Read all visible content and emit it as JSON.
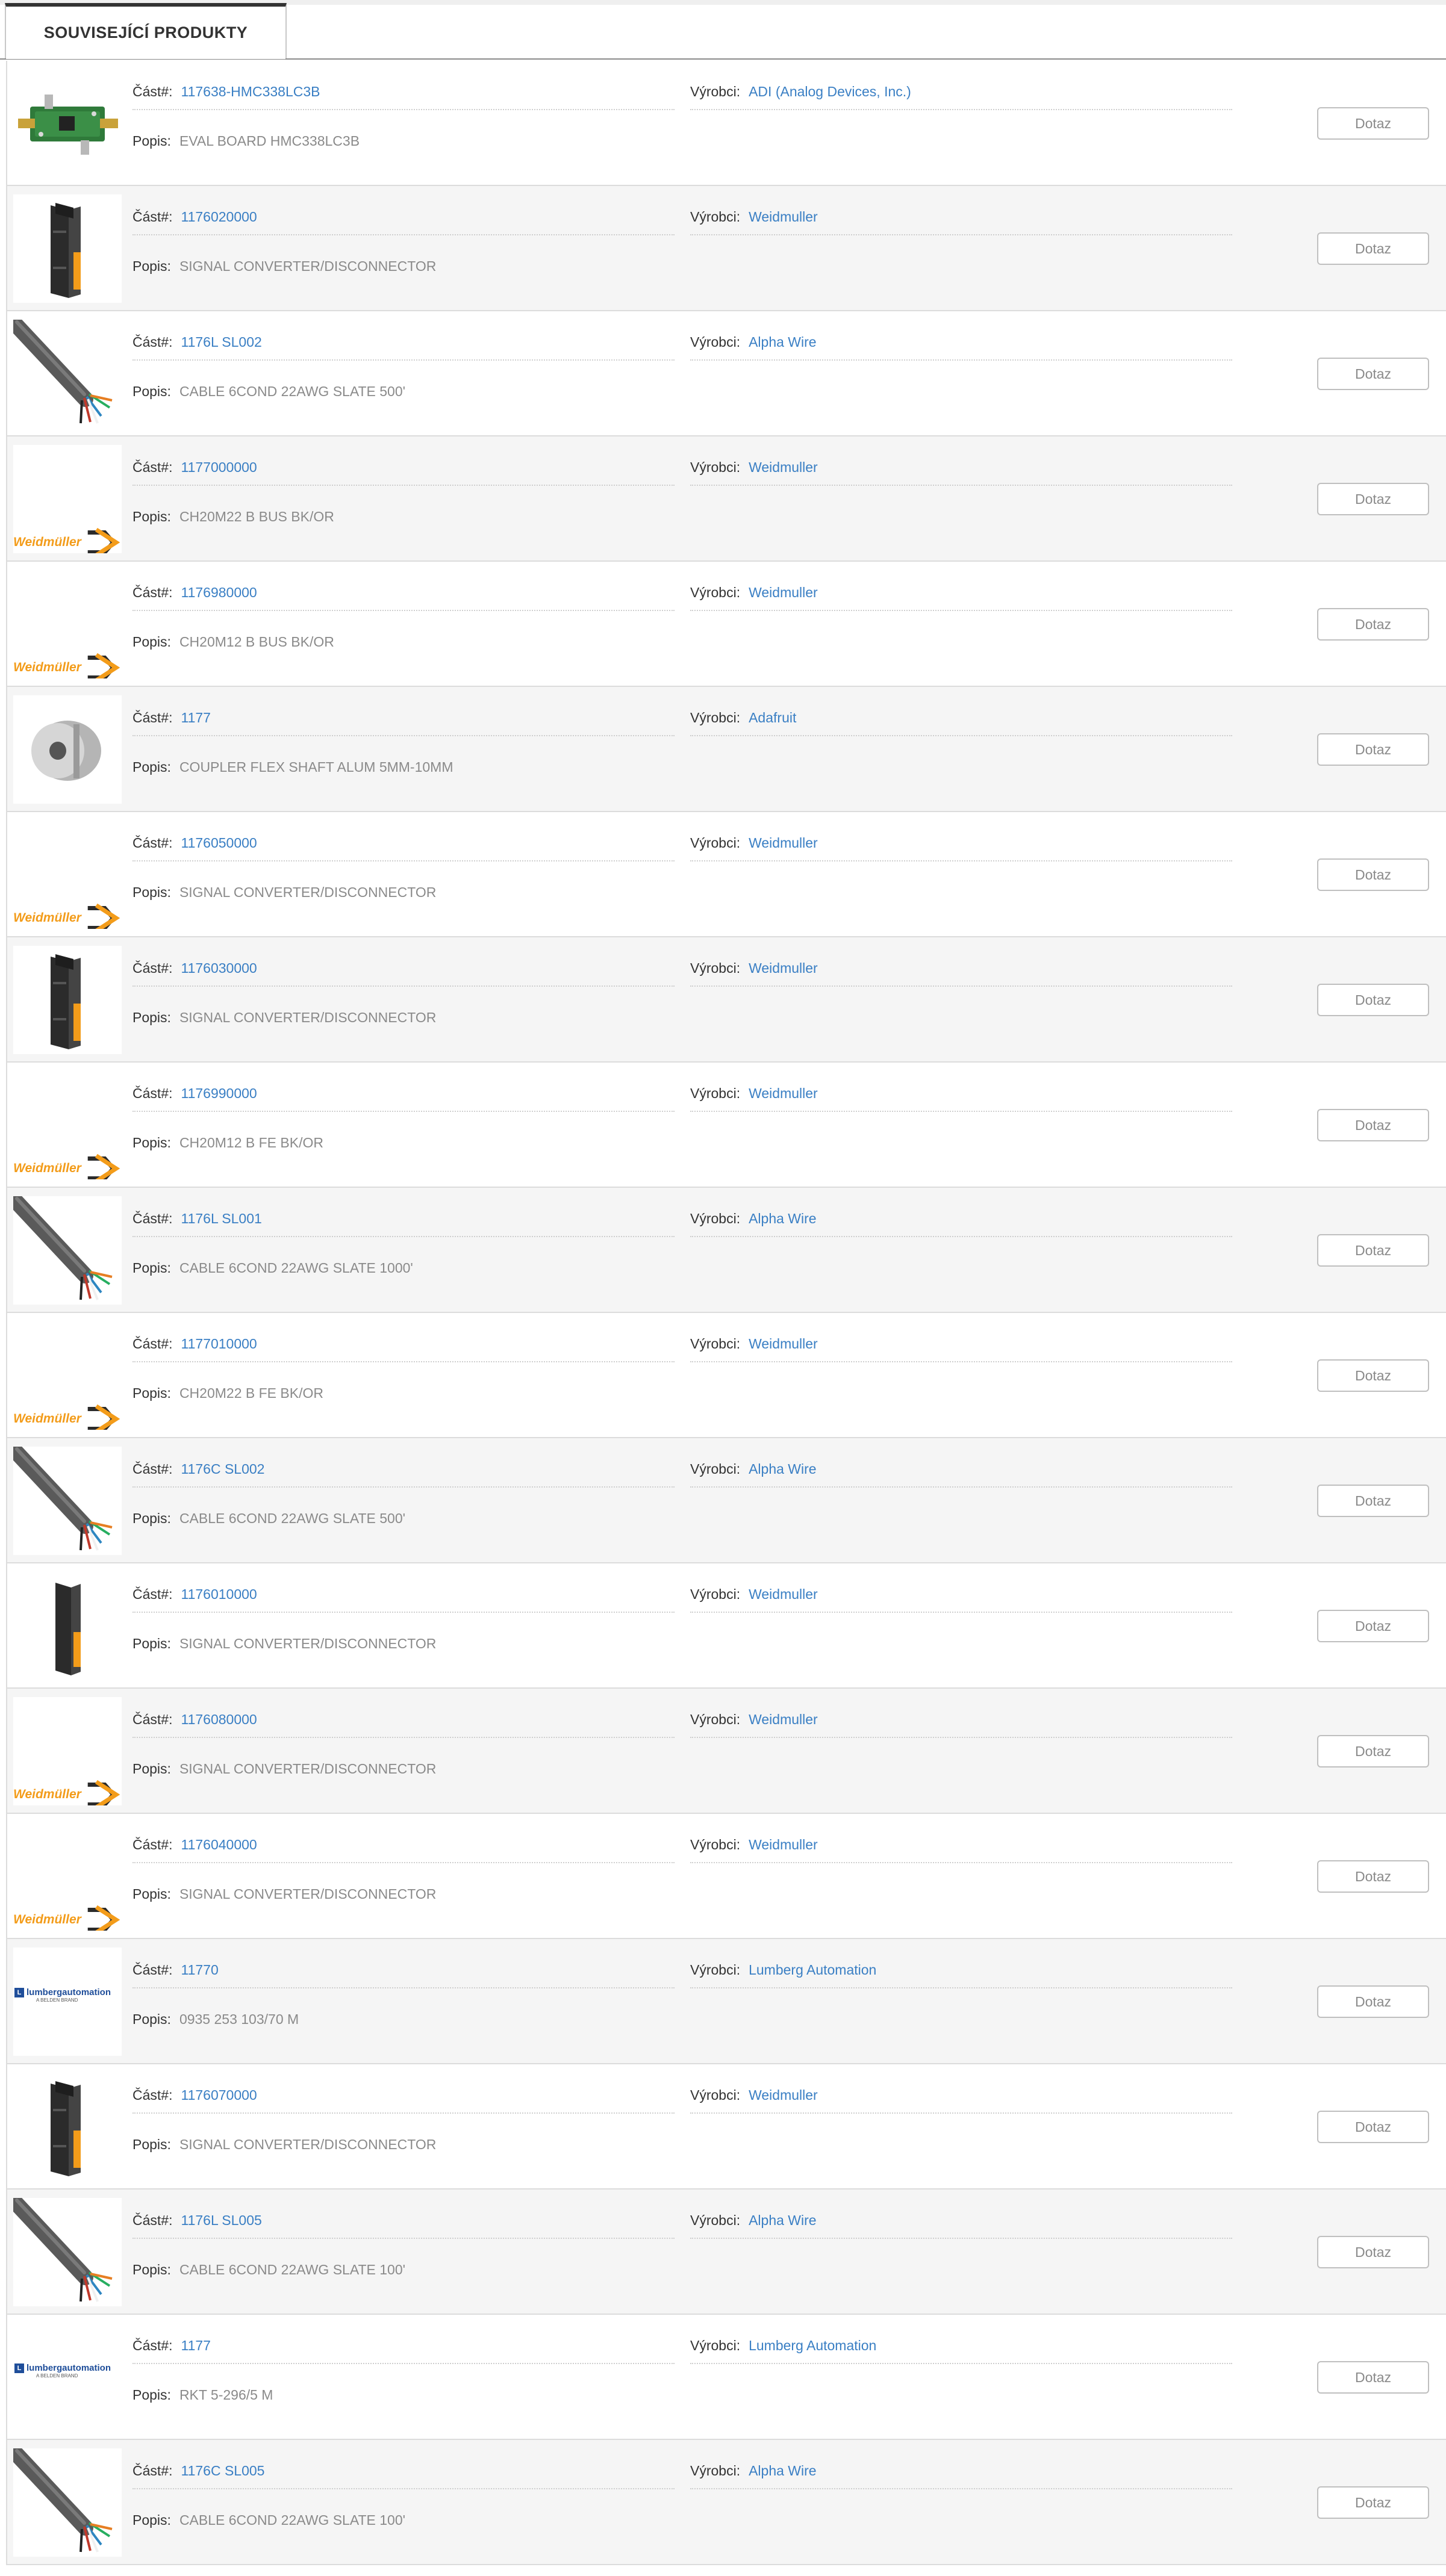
{
  "tab": {
    "label": "SOUVISEJÍCÍ PRODUKTY"
  },
  "labels": {
    "part": "Část#:",
    "manufacturer": "Výrobci:",
    "description": "Popis:",
    "inquiry": "Dotaz"
  },
  "brands": {
    "weidmuller": "Weidmüller",
    "lumberg": "lumbergautomation",
    "lumberg_sub": "A BELDEN BRAND"
  },
  "colors": {
    "link": "#3a7fc4",
    "weidmuller_orange": "#f39c1a",
    "alt_row": "#f5f5f5"
  },
  "products": [
    {
      "part": "117638-HMC338LC3B",
      "manufacturer": "ADI (Analog Devices, Inc.)",
      "description": "EVAL BOARD HMC338LC3B",
      "image": "eval-board-image"
    },
    {
      "part": "1176020000",
      "manufacturer": "Weidmuller",
      "description": "SIGNAL CONVERTER/DISCONNECTOR",
      "image": "converter-module-image"
    },
    {
      "part": "1176L SL002",
      "manufacturer": "Alpha Wire",
      "description": "CABLE 6COND 22AWG SLATE 500'",
      "image": "cable-image"
    },
    {
      "part": "1177000000",
      "manufacturer": "Weidmuller",
      "description": "CH20M22 B BUS BK/OR",
      "image": "weidmuller-logo"
    },
    {
      "part": "1176980000",
      "manufacturer": "Weidmuller",
      "description": "CH20M12 B BUS BK/OR",
      "image": "weidmuller-logo"
    },
    {
      "part": "1177",
      "manufacturer": "Adafruit",
      "description": "COUPLER FLEX SHAFT ALUM 5MM-10MM",
      "image": "coupler-image"
    },
    {
      "part": "1176050000",
      "manufacturer": "Weidmuller",
      "description": "SIGNAL CONVERTER/DISCONNECTOR",
      "image": "weidmuller-logo"
    },
    {
      "part": "1176030000",
      "manufacturer": "Weidmuller",
      "description": "SIGNAL CONVERTER/DISCONNECTOR",
      "image": "converter-module-image"
    },
    {
      "part": "1176990000",
      "manufacturer": "Weidmuller",
      "description": "CH20M12 B FE BK/OR",
      "image": "weidmuller-logo"
    },
    {
      "part": "1176L SL001",
      "manufacturer": "Alpha Wire",
      "description": "CABLE 6COND 22AWG SLATE 1000'",
      "image": "cable-image"
    },
    {
      "part": "1177010000",
      "manufacturer": "Weidmuller",
      "description": "CH20M22 B FE BK/OR",
      "image": "weidmuller-logo"
    },
    {
      "part": "1176C SL002",
      "manufacturer": "Alpha Wire",
      "description": "CABLE 6COND 22AWG SLATE 500'",
      "image": "cable-image"
    },
    {
      "part": "1176010000",
      "manufacturer": "Weidmuller",
      "description": "SIGNAL CONVERTER/DISCONNECTOR",
      "image": "converter-module-image-single"
    },
    {
      "part": "1176080000",
      "manufacturer": "Weidmuller",
      "description": "SIGNAL CONVERTER/DISCONNECTOR",
      "image": "weidmuller-logo"
    },
    {
      "part": "1176040000",
      "manufacturer": "Weidmuller",
      "description": "SIGNAL CONVERTER/DISCONNECTOR",
      "image": "weidmuller-logo"
    },
    {
      "part": "11770",
      "manufacturer": "Lumberg Automation",
      "description": "0935 253 103/70 M",
      "image": "lumberg-logo"
    },
    {
      "part": "1176070000",
      "manufacturer": "Weidmuller",
      "description": "SIGNAL CONVERTER/DISCONNECTOR",
      "image": "converter-module-image"
    },
    {
      "part": "1176L SL005",
      "manufacturer": "Alpha Wire",
      "description": "CABLE 6COND 22AWG SLATE 100'",
      "image": "cable-image"
    },
    {
      "part": "1177",
      "manufacturer": "Lumberg Automation",
      "description": "RKT 5-296/5 M",
      "image": "lumberg-logo"
    },
    {
      "part": "1176C SL005",
      "manufacturer": "Alpha Wire",
      "description": "CABLE 6COND 22AWG SLATE 100'",
      "image": "cable-image"
    }
  ]
}
